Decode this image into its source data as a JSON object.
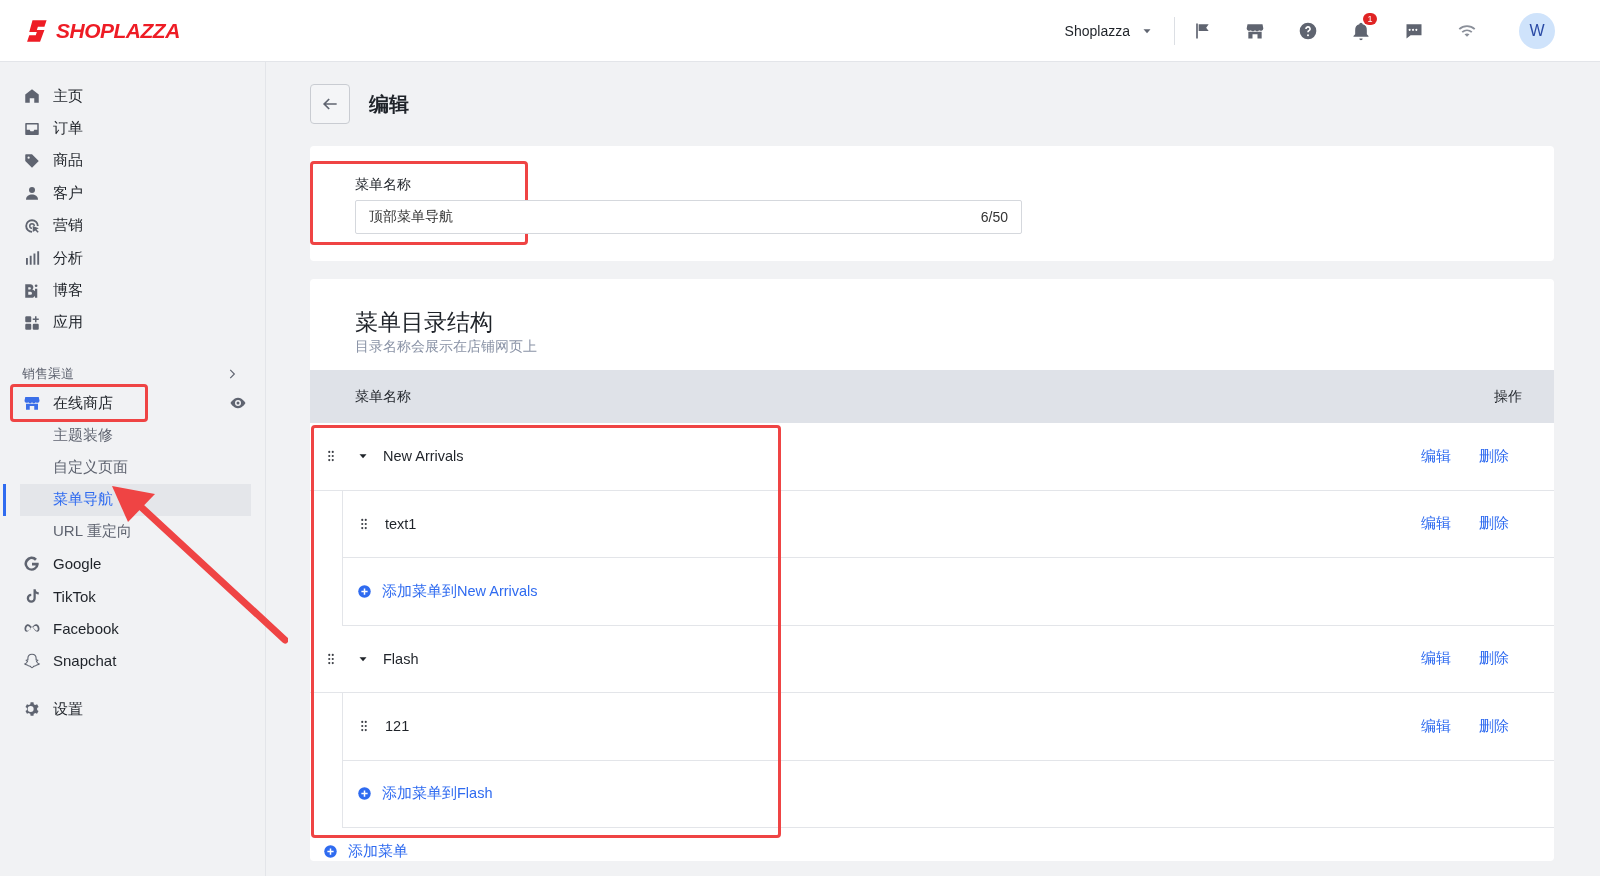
{
  "header": {
    "logo": "SHOPLAZZA",
    "store_name": "Shoplazza",
    "notification_count": "1",
    "avatar_initial": "W"
  },
  "sidebar": {
    "main_items": [
      {
        "label": "主页"
      },
      {
        "label": "订单"
      },
      {
        "label": "商品"
      },
      {
        "label": "客户"
      },
      {
        "label": "营销"
      },
      {
        "label": "分析"
      },
      {
        "label": "博客"
      },
      {
        "label": "应用"
      }
    ],
    "sales_channels": {
      "title": "销售渠道",
      "store": {
        "label": "在线商店"
      },
      "sub_items": [
        {
          "label": "主题装修",
          "selected": false
        },
        {
          "label": "自定义页面",
          "selected": false
        },
        {
          "label": "菜单导航",
          "selected": true
        },
        {
          "label": "URL 重定向",
          "selected": false
        }
      ],
      "channels": [
        {
          "label": "Google"
        },
        {
          "label": "TikTok"
        },
        {
          "label": "Facebook"
        },
        {
          "label": "Snapchat"
        }
      ]
    },
    "settings": {
      "label": "设置"
    }
  },
  "page": {
    "title": "编辑"
  },
  "name_card": {
    "label": "菜单名称",
    "value": "顶部菜单导航",
    "counter": "6/50"
  },
  "structure": {
    "title": "菜单目录结构",
    "subtitle": "目录名称会展示在店铺网页上",
    "columns": [
      "菜单名称",
      "操作"
    ],
    "items": [
      {
        "label": "New Arrivals",
        "expanded": true,
        "actions": [
          "编辑",
          "删除"
        ],
        "children": [
          {
            "label": "text1",
            "actions": [
              "编辑",
              "删除"
            ]
          }
        ],
        "add_link": "添加菜单到New Arrivals"
      },
      {
        "label": "Flash",
        "expanded": true,
        "actions": [
          "编辑",
          "删除"
        ],
        "children": [
          {
            "label": "121",
            "actions": [
              "编辑",
              "删除"
            ]
          }
        ],
        "add_link": "添加菜单到Flash"
      }
    ],
    "add_menu": "添加菜单"
  }
}
